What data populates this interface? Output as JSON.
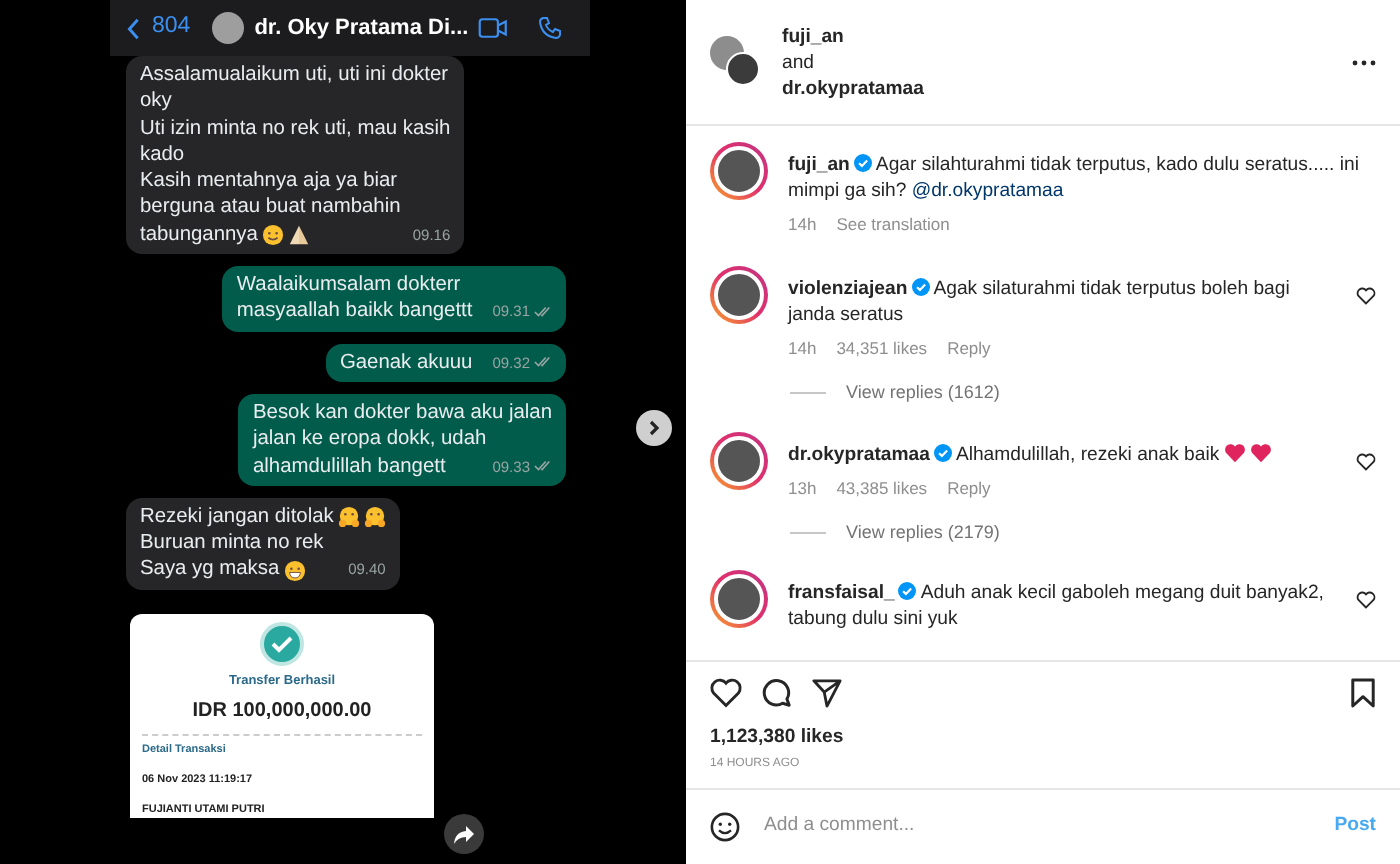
{
  "chat_screenshot": {
    "header": {
      "back_count": "804",
      "contact_name": "dr. Oky Pratama Di..."
    },
    "messages": [
      {
        "kind": "incoming",
        "lines": [
          {
            "text": "Assalamualaikum uti, uti ini dokter"
          },
          {
            "text": "oky"
          },
          {
            "text": "Uti izin minta no rek uti, mau kasih"
          },
          {
            "text": "kado"
          },
          {
            "text": "Kasih mentahnya aja ya biar"
          },
          {
            "text": "berguna atau buat nambahin"
          },
          {
            "text": "tabungannya",
            "emojis": [
              {
                "kind": "smile"
              },
              {
                "kind": "pray"
              }
            ]
          }
        ],
        "time": "09.16"
      },
      {
        "kind": "outgoing",
        "lines": [
          {
            "text": "Waalaikumsalam dokterr"
          },
          {
            "text": "masyaallah baikk bangettt"
          }
        ],
        "time": "09.31"
      },
      {
        "kind": "outgoing",
        "lines": [
          {
            "text": "Gaenak akuuu"
          }
        ],
        "time": "09.32"
      },
      {
        "kind": "outgoing",
        "lines": [
          {
            "text": "Besok kan dokter bawa aku jalan"
          },
          {
            "text": "jalan ke eropa dokk, udah"
          },
          {
            "text": "alhamdulillah bangett"
          }
        ],
        "time": "09.33"
      },
      {
        "kind": "incoming",
        "lines": [
          {
            "text": "Rezeki jangan ditolak",
            "emojis": [
              {
                "kind": "hug"
              },
              {
                "kind": "hug"
              }
            ]
          },
          {
            "text": "Buruan minta no rek"
          },
          {
            "text": "Saya yg maksa",
            "emojis": [
              {
                "kind": "grin"
              }
            ]
          }
        ],
        "time": "09.40"
      }
    ],
    "receipt": {
      "title": "Transfer Berhasil",
      "amount": "IDR 100,000,000.00",
      "section": "Detail Transaksi",
      "date": "06 Nov 2023 11:19:17",
      "recipient": "FUJIANTI UTAMI PUTRI"
    }
  },
  "post": {
    "authors": [
      "fuji_an",
      "dr.okypratamaa"
    ],
    "joiner": "and",
    "comments": [
      {
        "username": "fuji_an",
        "verified": true,
        "text": "Agar silahturahmi tidak terputus, kado dulu seratus..... ini mimpi ga sih?",
        "mention": "@dr.okypratamaa",
        "time": "14h",
        "see_translation": "See translation"
      },
      {
        "username": "violenziajean",
        "verified": true,
        "text": "Agak silaturahmi tidak terputus boleh bagi janda seratus",
        "time": "14h",
        "likes": "34,351 likes",
        "reply": "Reply",
        "view_replies": "View replies (1612)",
        "likeable": true
      },
      {
        "username": "dr.okypratamaa",
        "verified": true,
        "text": "Alhamdulillah, rezeki anak baik",
        "emojis": [
          {
            "kind": "heart"
          },
          {
            "kind": "heart"
          }
        ],
        "time": "13h",
        "likes": "43,385 likes",
        "reply": "Reply",
        "view_replies": "View replies (2179)",
        "likeable": true
      },
      {
        "username": "fransfaisal_",
        "verified": true,
        "text": "Aduh anak kecil gaboleh megang duit banyak2, tabung dulu sini yuk",
        "likeable": true
      }
    ],
    "likes": "1,123,380 likes",
    "time_ago": "14 HOURS AGO",
    "comment_field": {
      "placeholder": "Add a comment...",
      "button": "Post"
    }
  }
}
